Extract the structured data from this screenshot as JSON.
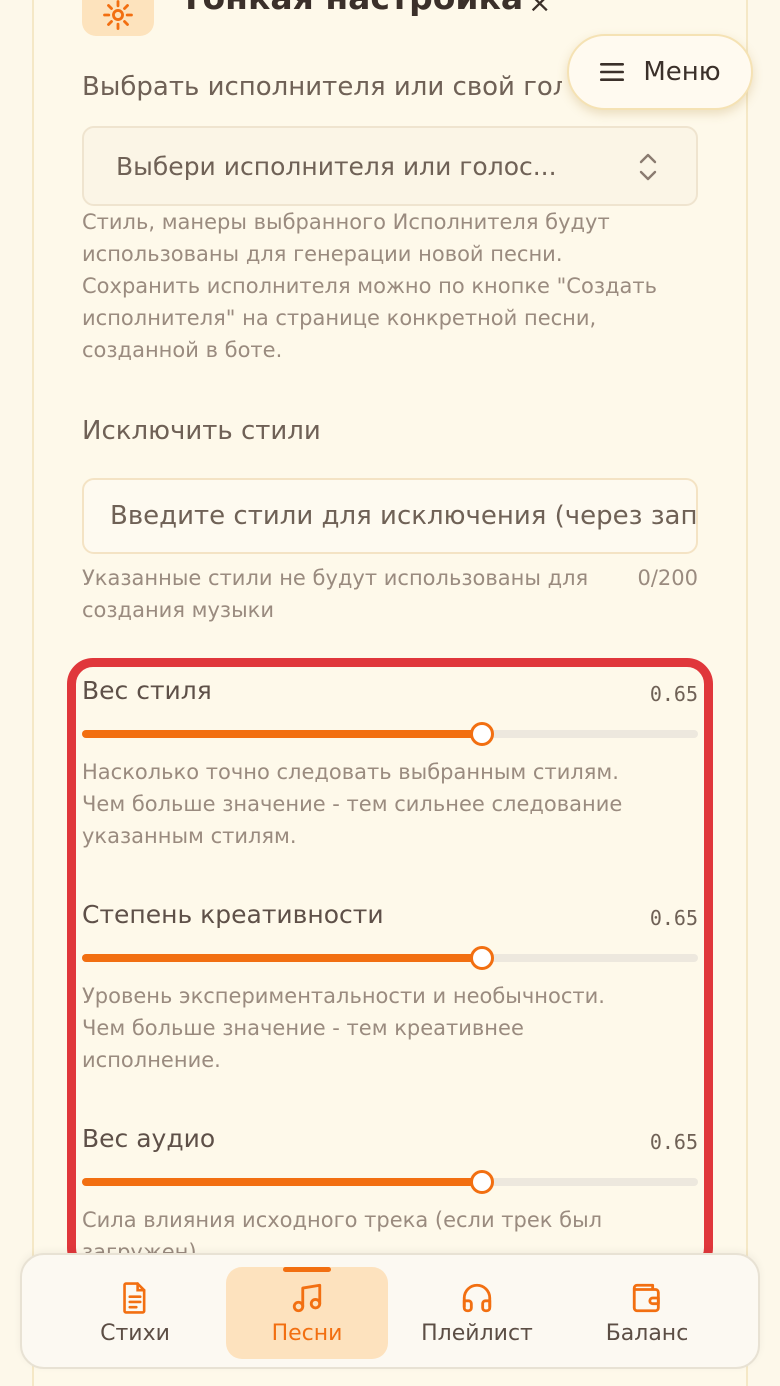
{
  "header": {
    "title": "Тонкая настройка",
    "close_glyph": "×",
    "icon": "gear-icon"
  },
  "menu_button": {
    "label": "Меню",
    "icon": "hamburger-icon"
  },
  "artist": {
    "label": "Выбрать исполнителя или свой голос",
    "select_value": "Выбери исполнителя или голос...",
    "help_lines": [
      "Стиль, манеры выбранного Исполнителя будут",
      "использованы для генерации новой песни.",
      "Сохранить исполнителя можно по кнопке \"Создать",
      "исполнителя\" на странице конкретной песни,",
      "созданной в боте."
    ]
  },
  "exclude_styles": {
    "label": "Исключить стили",
    "placeholder": "Введите стили для исключения (через запятую)",
    "help_lines": [
      "Указанные стили не будут использованы для",
      "создания музыки"
    ],
    "counter": "0/200"
  },
  "sliders": [
    {
      "label": "Вес стиля",
      "value_text": "0.65",
      "value": 0.65,
      "help_lines": [
        "Насколько точно следовать выбранным стилям.",
        "Чем больше значение - тем сильнее следование",
        "указанным стилям."
      ]
    },
    {
      "label": "Степень креативности",
      "value_text": "0.65",
      "value": 0.65,
      "help_lines": [
        "Уровень экспериментальности и необычности.",
        "Чем больше значение - тем креативнее",
        "исполнение."
      ]
    },
    {
      "label": "Вес аудио",
      "value_text": "0.65",
      "value": 0.65,
      "help_lines": [
        "Сила влияния исходного трека (если трек был",
        "загружен)"
      ]
    }
  ],
  "bottom_nav": {
    "items": [
      {
        "label": "Стихи",
        "icon": "document-icon",
        "active": false
      },
      {
        "label": "Песни",
        "icon": "music-note-icon",
        "active": true
      },
      {
        "label": "Плейлист",
        "icon": "headphones-icon",
        "active": false
      },
      {
        "label": "Баланс",
        "icon": "wallet-icon",
        "active": false
      }
    ]
  },
  "colors": {
    "accent": "#f26f11",
    "highlight": "#e0373b",
    "background": "#fdf8ea"
  }
}
